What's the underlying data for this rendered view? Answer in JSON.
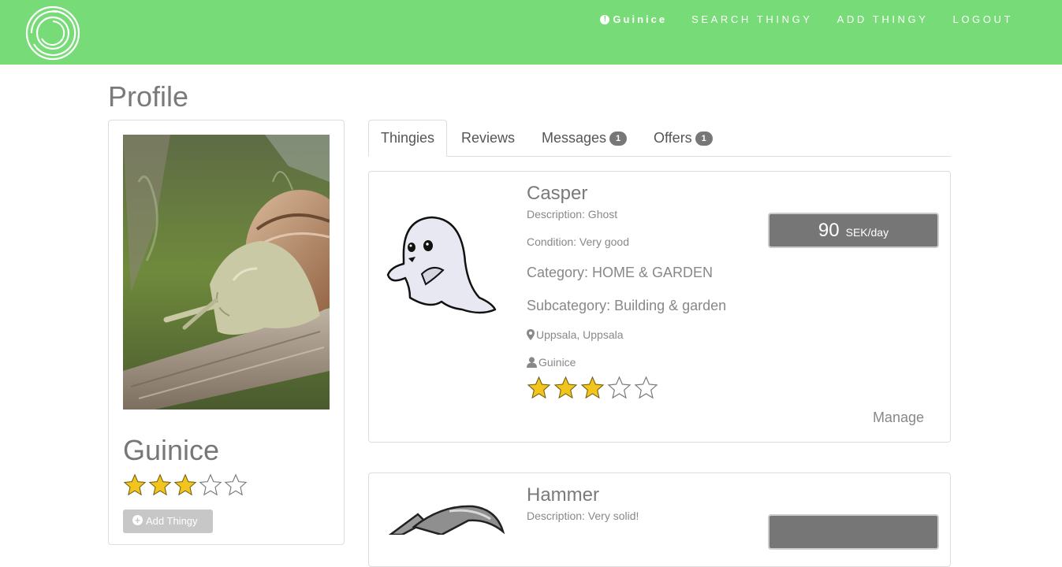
{
  "nav": {
    "username": "Guinice",
    "search": "SEARCH THINGY",
    "add": "ADD THINGY",
    "logout": "LOGOUT",
    "bg_color": "#77db77"
  },
  "page": {
    "title": "Profile"
  },
  "profile": {
    "name": "Guinice",
    "rating": 3,
    "max_rating": 5,
    "add_button": "Add Thingy"
  },
  "tabs": [
    {
      "label": "Thingies",
      "active": true
    },
    {
      "label": "Reviews"
    },
    {
      "label": "Messages",
      "badge": "1"
    },
    {
      "label": "Offers",
      "badge": "1"
    }
  ],
  "items": [
    {
      "title": "Casper",
      "description": "Description: Ghost",
      "condition": "Condition: Very good",
      "category": "Category: HOME & GARDEN",
      "subcategory": "Subcategory: Building & garden",
      "location": "Uppsala, Uppsala",
      "owner": "Guinice",
      "rating": 3,
      "price": "90",
      "price_unit": "SEK/day",
      "manage": "Manage"
    },
    {
      "title": "Hammer",
      "description": "Description: Very solid!"
    }
  ],
  "icons": {
    "alert": "exclamation-circle-icon",
    "logo": "circles-logo",
    "location": "map-marker-icon",
    "user": "user-icon",
    "plus": "plus-circle-icon",
    "star": "star-icon"
  },
  "colors": {
    "star_fill": "#f2c51d",
    "price_bg": "#767676",
    "badge_bg": "#777777"
  }
}
